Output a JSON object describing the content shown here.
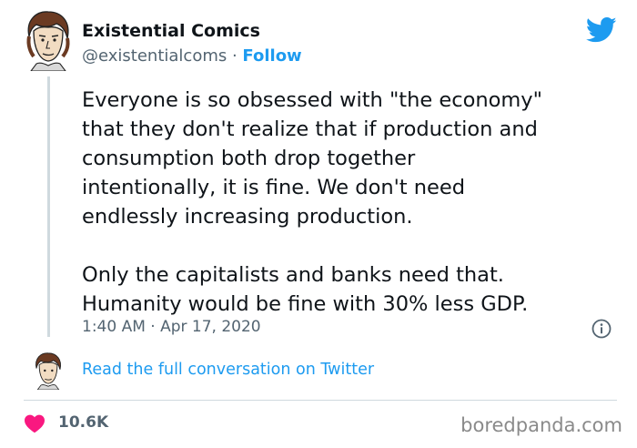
{
  "tweet": {
    "author_name": "Existential Comics",
    "handle": "@existentialcoms",
    "separator": " · ",
    "follow_label": "Follow",
    "paragraphs": [
      "Everyone is so obsessed with \"the economy\"\nthat they don't realize that if production and\nconsumption both drop together\nintentionally, it is fine. We don't need\nendlessly increasing production.",
      "Only the capitalists and banks need that.\nHumanity would be fine with 30% less GDP."
    ],
    "time": "1:40 AM",
    "date": "Apr 17, 2020",
    "read_link": "Read the full conversation on Twitter",
    "likes": "10.6K"
  },
  "icons": {
    "brand": "twitter-bird-icon",
    "info": "info-icon",
    "like": "heart-icon"
  },
  "colors": {
    "accent": "#1d9bf0",
    "like": "#f91880",
    "muted": "#536471",
    "text": "#0f1419"
  },
  "watermark": "boredpanda.com"
}
